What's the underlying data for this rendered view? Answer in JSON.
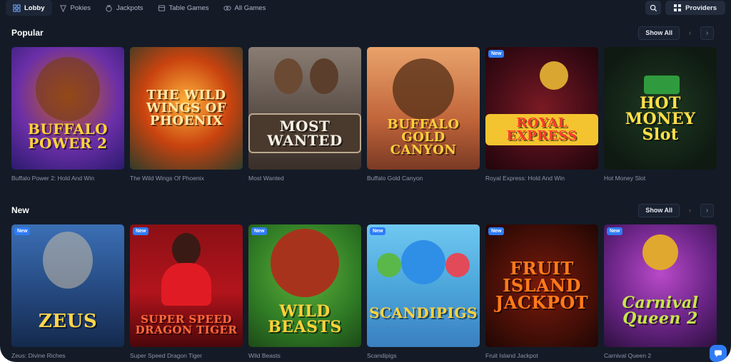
{
  "nav": {
    "tabs": [
      {
        "label": "Lobby",
        "icon": "grid-icon",
        "active": true
      },
      {
        "label": "Pokies",
        "icon": "slot-icon",
        "active": false
      },
      {
        "label": "Jackpots",
        "icon": "moneybag-icon",
        "active": false
      },
      {
        "label": "Table Games",
        "icon": "table-icon",
        "active": false
      },
      {
        "label": "All Games",
        "icon": "games-icon",
        "active": false
      }
    ],
    "providers_label": "Providers"
  },
  "popular": {
    "title": "Popular",
    "show_all": "Show All",
    "games": [
      {
        "name": "Buffalo Power 2: Hold And Win",
        "art": "BUFFALO POWER 2",
        "new": false
      },
      {
        "name": "The Wild Wings Of Phoenix",
        "art": "THE WILD WINGS OF PHOENIX",
        "new": false
      },
      {
        "name": "Most Wanted",
        "art": "MOST WANTED",
        "new": false
      },
      {
        "name": "Buffalo Gold Canyon",
        "art": "BUFFALO GOLD CANYON",
        "new": false
      },
      {
        "name": "Royal Express: Hold And Win",
        "art": "ROYAL EXPRESS",
        "new": true
      },
      {
        "name": "Hot Money Slot",
        "art": "HOT MONEY Slot",
        "new": false
      }
    ]
  },
  "new": {
    "title": "New",
    "show_all": "Show All",
    "games": [
      {
        "name": "Zeus: Divine Riches",
        "art": "ZEUS",
        "new": true
      },
      {
        "name": "Super Speed Dragon Tiger",
        "art": "SUPER SPEED DRAGON TIGER",
        "new": true
      },
      {
        "name": "Wild Beasts",
        "art": "WILD BEASTS",
        "new": true
      },
      {
        "name": "Scandipigs",
        "art": "SCANDIPIGS",
        "new": true
      },
      {
        "name": "Fruit Island Jackpot",
        "art": "FRUIT ISLAND JACKPOT",
        "new": true
      },
      {
        "name": "Carnival Queen 2",
        "art": "Carnival Queen 2",
        "new": true
      }
    ]
  },
  "badge_label": "New",
  "colors": {
    "accent": "#2f7cf6",
    "background": "#141b27"
  }
}
